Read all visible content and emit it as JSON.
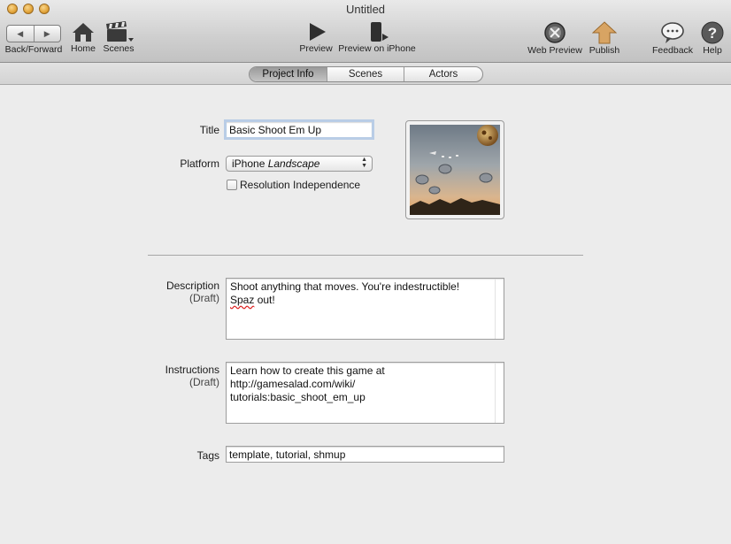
{
  "window": {
    "title": "Untitled"
  },
  "toolbar": {
    "back_forward": "Back/Forward",
    "home": "Home",
    "scenes": "Scenes",
    "preview": "Preview",
    "preview_iphone": "Preview on iPhone",
    "web_preview": "Web Preview",
    "publish": "Publish",
    "feedback": "Feedback",
    "help": "Help"
  },
  "tabs": [
    {
      "label": "Project Info",
      "active": true
    },
    {
      "label": "Scenes",
      "active": false
    },
    {
      "label": "Actors",
      "active": false
    }
  ],
  "form": {
    "title_label": "Title",
    "title_value": "Basic Shoot Em Up",
    "platform_label": "Platform",
    "platform_value_prefix": "iPhone ",
    "platform_value_italic": "Landscape",
    "resolution_label": "Resolution Independence",
    "resolution_checked": false,
    "description_label": "Description",
    "description_sub": "(Draft)",
    "description_line1": "Shoot anything that moves. You're indestructible!",
    "description_word_misspelled": "Spaz",
    "description_line2_rest": " out!",
    "instructions_label": "Instructions",
    "instructions_sub": "(Draft)",
    "instructions_lines": [
      "Learn how to create this game at",
      "http://gamesalad.com/wiki/",
      "tutorials:basic_shoot_em_up"
    ],
    "tags_label": "Tags",
    "tags_value": "template, tutorial, shmup"
  },
  "colors": {
    "window_bg": "#ececec",
    "focus_ring": "#b9cde6",
    "traffic_light": "#e2a43a"
  }
}
